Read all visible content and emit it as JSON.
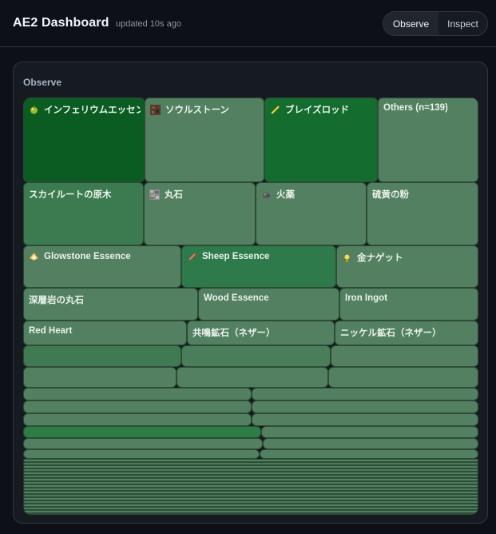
{
  "header": {
    "title": "AE2 Dashboard",
    "updated": "updated 10s ago",
    "tabs": [
      {
        "label": "Observe",
        "active": true
      },
      {
        "label": "Inspect",
        "active": false
      }
    ]
  },
  "panel": {
    "title": "Observe"
  },
  "colors": {
    "background": "#0d1117",
    "panel": "#161b22",
    "border": "#30363d",
    "tile_dark_green": "#0b5c22",
    "tile_green": "#137030",
    "tile_mid_green": "#2e7a4b",
    "tile_default": "#528060"
  },
  "treemap": {
    "items": [
      {
        "label": "インフェリウムエッセンス",
        "icon": "inferium-essence-icon",
        "color": "#0b5c22"
      },
      {
        "label": "ソウルストーン",
        "icon": "soulstone-icon",
        "color": "#528060"
      },
      {
        "label": "ブレイズロッド",
        "icon": "blaze-rod-icon",
        "color": "#146c2f"
      },
      {
        "label": "Others (n=139)",
        "icon": "",
        "color": "#528060"
      },
      {
        "label": "スカイルートの原木",
        "icon": "",
        "color": "#3c7a4f"
      },
      {
        "label": "丸石",
        "icon": "cobblestone-icon",
        "color": "#528060"
      },
      {
        "label": "火薬",
        "icon": "gunpowder-icon",
        "color": "#528060"
      },
      {
        "label": "硫黄の粉",
        "icon": "",
        "color": "#528060"
      },
      {
        "label": "Glowstone Essence",
        "icon": "glowstone-essence-icon",
        "color": "#528060"
      },
      {
        "label": "Sheep Essence",
        "icon": "sheep-essence-icon",
        "color": "#2e7a4b"
      },
      {
        "label": "金ナゲット",
        "icon": "gold-nugget-icon",
        "color": "#528060"
      },
      {
        "label": "深層岩の丸石",
        "icon": "",
        "color": "#528060"
      },
      {
        "label": "Wood Essence",
        "icon": "",
        "color": "#528060"
      },
      {
        "label": "Iron Ingot",
        "icon": "",
        "color": "#528060"
      },
      {
        "label": "Red Heart",
        "icon": "",
        "color": "#528060"
      },
      {
        "label": "共鳴鉱石（ネザー）",
        "icon": "",
        "color": "#528060"
      },
      {
        "label": "ニッケル鉱石（ネザー）",
        "icon": "",
        "color": "#528060"
      },
      {
        "label": "",
        "icon": "",
        "color": "#3f7a52"
      },
      {
        "label": "",
        "icon": "",
        "color": "#4a7d5a"
      },
      {
        "label": "",
        "icon": "",
        "color": "#528060"
      },
      {
        "label": "",
        "icon": "",
        "color": "#528060"
      },
      {
        "label": "",
        "icon": "",
        "color": "#528060"
      },
      {
        "label": "",
        "icon": "",
        "color": "#528060"
      },
      {
        "label": "",
        "icon": "",
        "color": "#528060"
      },
      {
        "label": "",
        "icon": "",
        "color": "#528060"
      },
      {
        "label": "",
        "icon": "",
        "color": "#528060"
      },
      {
        "label": "",
        "icon": "",
        "color": "#528060"
      },
      {
        "label": "",
        "icon": "",
        "color": "#528060"
      },
      {
        "label": "",
        "icon": "",
        "color": "#528060"
      },
      {
        "label": "",
        "icon": "",
        "color": "#2f7d46"
      },
      {
        "label": "",
        "icon": "",
        "color": "#528060"
      },
      {
        "label": "",
        "icon": "",
        "color": "#528060"
      },
      {
        "label": "",
        "icon": "",
        "color": "#528060"
      },
      {
        "label": "",
        "icon": "",
        "color": "#528060"
      },
      {
        "label": "",
        "icon": "",
        "color": "#528060"
      }
    ]
  }
}
